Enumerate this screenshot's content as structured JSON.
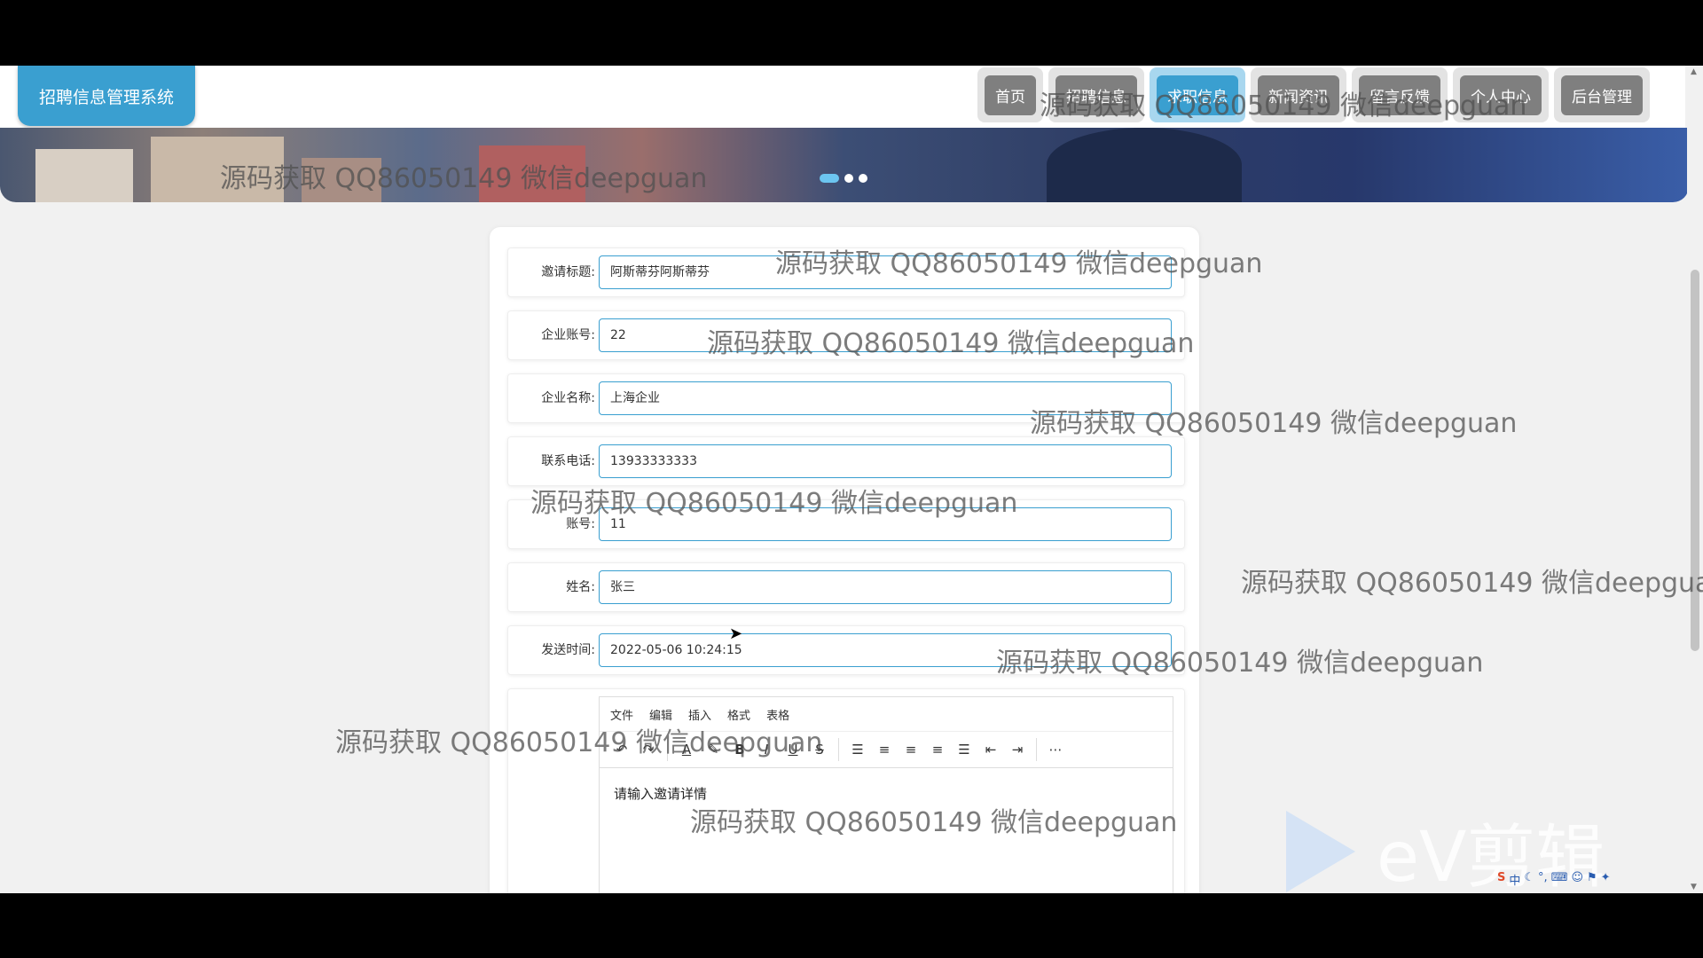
{
  "app": {
    "title": "招聘信息管理系统"
  },
  "nav": {
    "items": [
      {
        "label": "首页",
        "active": false
      },
      {
        "label": "招聘信息",
        "active": false
      },
      {
        "label": "求职信息",
        "active": true
      },
      {
        "label": "新闻资讯",
        "active": false
      },
      {
        "label": "留言反馈",
        "active": false
      },
      {
        "label": "个人中心",
        "active": false
      },
      {
        "label": "后台管理",
        "active": false
      }
    ]
  },
  "banner": {
    "dots": 3,
    "active_dot": 0
  },
  "form": {
    "fields": [
      {
        "label": "邀请标题:",
        "value": "阿斯蒂芬阿斯蒂芬"
      },
      {
        "label": "企业账号:",
        "value": "22"
      },
      {
        "label": "企业名称:",
        "value": "上海企业"
      },
      {
        "label": "联系电话:",
        "value": "13933333333"
      },
      {
        "label": "账号:",
        "value": "11"
      },
      {
        "label": "姓名:",
        "value": "张三"
      },
      {
        "label": "发送时间:",
        "value": "2022-05-06 10:24:15"
      }
    ],
    "editor": {
      "menu": [
        "文件",
        "编辑",
        "插入",
        "格式",
        "表格"
      ],
      "placeholder": "请输入邀请详情",
      "toolbar_icons": [
        "undo-icon",
        "redo-icon",
        "font-color-icon",
        "highlight-icon",
        "bold-icon",
        "italic-icon",
        "underline-icon",
        "strikethrough-icon",
        "list-icon",
        "align-left-icon",
        "align-center-icon",
        "align-right-icon",
        "justify-icon",
        "outdent-icon",
        "indent-icon",
        "more-icon"
      ]
    }
  },
  "watermark": {
    "text": "源码获取 QQ86050149 微信deepguan",
    "partial_text": "源码获取 QQ86050149 微信deepgua"
  },
  "overlay": {
    "logo_text": "eV剪辑"
  },
  "colors": {
    "accent": "#3a9fd0",
    "nav_inactive": "#7f7f7f",
    "background": "#f1f1f1"
  }
}
